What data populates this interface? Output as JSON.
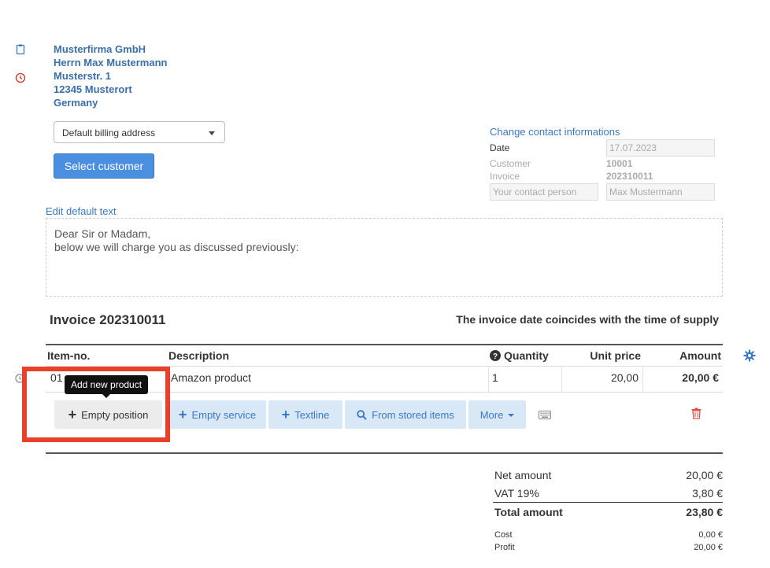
{
  "address": {
    "company": "Musterfirma GmbH",
    "name": "Herrn Max Mustermann",
    "street": "Musterstr. 1",
    "city": "12345 Musterort",
    "country": "Germany"
  },
  "billing_select": {
    "value": "Default billing address"
  },
  "select_customer_label": "Select customer",
  "contact": {
    "change_link": "Change contact informations",
    "date_label": "Date",
    "date_value": "17.07.2023",
    "customer_label": "Customer",
    "customer_value": "10001",
    "invoice_label": "Invoice",
    "invoice_value": "202310011",
    "contact_person_placeholder": "Your contact person",
    "contact_person_value": "Max Mustermann"
  },
  "default_text": {
    "edit_link": "Edit default text",
    "line1": "Dear Sir or Madam,",
    "line2": "below we will charge you as discussed previously:"
  },
  "invoice": {
    "title": "Invoice 202310011",
    "supply_note": "The invoice date coincides with the time of supply"
  },
  "table": {
    "headers": {
      "item_no": "Item-no.",
      "description": "Description",
      "quantity": "Quantity",
      "unit_price": "Unit price",
      "amount": "Amount"
    },
    "rows": [
      {
        "item_no": "01",
        "description": "Amazon product",
        "quantity": "1",
        "unit_price": "20,00",
        "amount": "20,00 €"
      }
    ]
  },
  "tooltip": "Add new product",
  "position_buttons": {
    "empty_position": "Empty position",
    "empty_service": "Empty service",
    "textline": "Textline",
    "from_stored": "From stored items",
    "more": "More"
  },
  "totals": {
    "net_label": "Net amount",
    "net_value": "20,00 €",
    "vat_label": "VAT 19%",
    "vat_value": "3,80 €",
    "total_label": "Total amount",
    "total_value": "23,80 €",
    "cost_label": "Cost",
    "cost_value": "0,00 €",
    "profit_label": "Profit",
    "profit_value": "20,00 €"
  },
  "colors": {
    "accent": "#3a78c4",
    "primary_button": "#4a8fe0",
    "highlight": "#e8402a",
    "delete": "#d9534f"
  },
  "icons": [
    "clipboard-icon",
    "clock-icon",
    "caret-down-icon",
    "question-circle-icon",
    "gear-icon",
    "plus-icon",
    "search-icon",
    "keyboard-icon",
    "trash-icon"
  ]
}
